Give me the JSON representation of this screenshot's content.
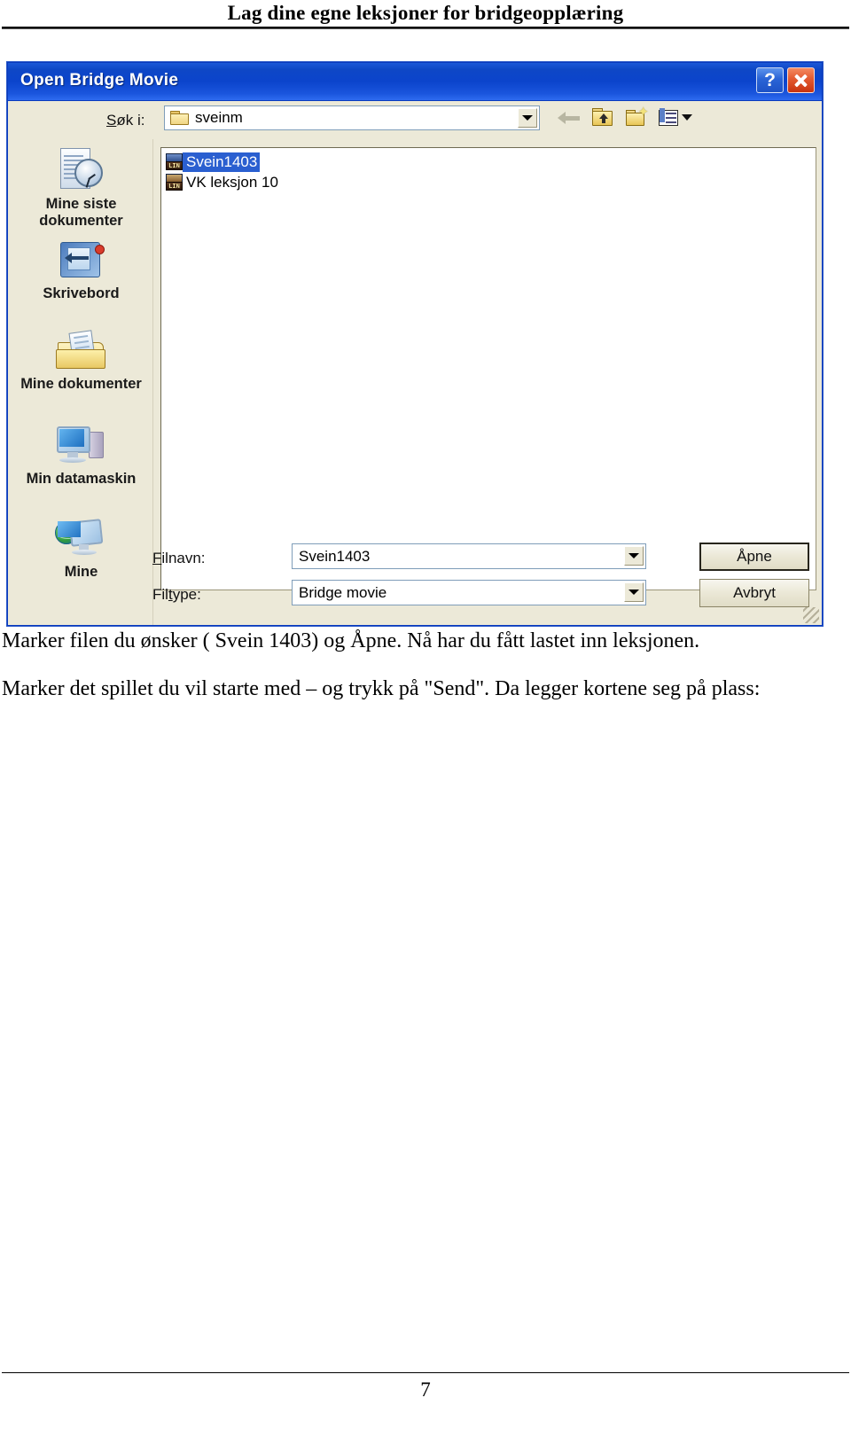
{
  "page": {
    "header_title": "Lag dine egne leksjoner for bridgeopplæring",
    "footer_page_number": "7"
  },
  "dialog": {
    "title": "Open Bridge Movie",
    "titlebar_buttons": [
      {
        "name": "help-button",
        "glyph": "?"
      },
      {
        "name": "close-button",
        "glyph": "✕"
      }
    ],
    "lookin": {
      "label": "Søk i:",
      "label_accel": "S",
      "label_rest": "øk i:",
      "value": "sveinm",
      "folder_icon": "folder-icon"
    },
    "toolbar": {
      "back_icon": "back-arrow-icon",
      "up_icon": "up-one-level-icon",
      "new_folder_icon": "new-folder-icon",
      "views_icon": "views-icon"
    },
    "places": [
      {
        "label": "Mine siste\ndokumenter",
        "icon": "recent-documents-icon"
      },
      {
        "label": "Skrivebord",
        "icon": "desktop-icon"
      },
      {
        "label": "Mine dokumenter",
        "icon": "my-documents-icon"
      },
      {
        "label": "Min datamaskin",
        "icon": "my-computer-icon"
      },
      {
        "label": "Mine",
        "icon": "my-network-places-icon"
      }
    ],
    "files": [
      {
        "name": "Svein1403",
        "selected": true,
        "icon_text": "LIN"
      },
      {
        "name": "VK leksjon 10",
        "selected": false,
        "icon_text": "LIN"
      }
    ],
    "filename_field": {
      "label": "Filnavn:",
      "label_accel": "F",
      "label_rest": "ilnavn:",
      "value": "Svein1403"
    },
    "filetype_field": {
      "label": "Filtype:",
      "label_pre": "Fil",
      "label_accel": "t",
      "label_post": "ype:",
      "value": "Bridge movie"
    },
    "buttons": {
      "open_pre": "Å",
      "open_accel": "p",
      "open_post": "ne",
      "open": "Åpne",
      "cancel": "Avbryt"
    },
    "colors": {
      "titlebar_blue": "#0b44cc",
      "dialog_face": "#ece9d8",
      "selection_blue": "#2a5fd0",
      "close_red": "#c8330f"
    }
  },
  "body": {
    "paragraph_1": "Marker filen du ønsker ( Svein 1403) og  Åpne. Nå har du fått lastet inn leksjonen.",
    "paragraph_2": "Marker det spillet du vil starte med – og trykk på \"Send\". Da legger kortene seg på plass:"
  }
}
